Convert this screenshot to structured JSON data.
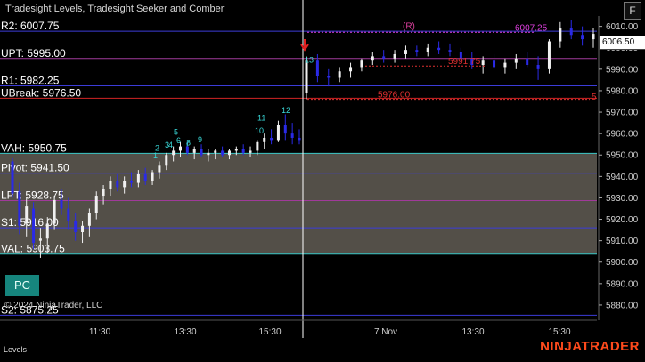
{
  "window": {
    "title": "Tradesight Levels, Tradesight Seeker and Comber",
    "f_label": "F",
    "pc_label": "PC",
    "copyright": "© 2024 NinjaTrader, LLC",
    "footer_left": "Levels",
    "brand": "NINJATRADER"
  },
  "chart_data": {
    "type": "candlestick",
    "instrument_price_label": "6006.50",
    "last_price": 6006.5,
    "ylim": [
      5875,
      6014
    ],
    "y_ticks": [
      5880,
      5890,
      5900,
      5910,
      5920,
      5930,
      5940,
      5950,
      5960,
      5970,
      5980,
      5990,
      6000,
      6010
    ],
    "x_tick_labels": [
      "11:30",
      "13:30",
      "15:30",
      "7 Nov",
      "13:30",
      "15:30"
    ],
    "session_break": "7 Nov",
    "levels": [
      {
        "label": "R2: 6007.75",
        "value": 6007.75,
        "color": "#3c3cd8"
      },
      {
        "label": "UPT: 5995.00",
        "value": 5995.0,
        "color": "#a03a9a"
      },
      {
        "label": "R1: 5982.25",
        "value": 5982.25,
        "color": "#3c3cd8"
      },
      {
        "label": "UBreak: 5976.50",
        "value": 5976.5,
        "color": "#d22424"
      },
      {
        "label": "VAH: 5950.75",
        "value": 5950.75,
        "color": "#38c6c6"
      },
      {
        "label": "Pivot: 5941.50",
        "value": 5941.5,
        "color": "#3c3cd8"
      },
      {
        "label": "LPT: 5928.75",
        "value": 5928.75,
        "color": "#a03a9a"
      },
      {
        "label": "S1: 5916.00",
        "value": 5916.0,
        "color": "#3c3cd8"
      },
      {
        "label": "VAL: 5903.75",
        "value": 5903.75,
        "color": "#38c6c6"
      },
      {
        "label": "S2: 5875.25",
        "value": 5875.25,
        "color": "#3c3cd8"
      }
    ],
    "value_area": {
      "from": 5903.75,
      "to": 5950.75,
      "color": "#5c5850"
    },
    "annotations": [
      {
        "text": "6007.25",
        "value": 6007.25,
        "color": "#e040e0"
      },
      {
        "text": "(R)",
        "value": 6008.0,
        "color": "#e040a0"
      },
      {
        "text": "5991.75",
        "value": 5991.5,
        "color": "#e03030"
      },
      {
        "text": "5976.00",
        "value": 5976.0,
        "color": "#e03030"
      },
      {
        "text": "5",
        "value": 5975.0,
        "color": "#e03030"
      }
    ],
    "seeker_counts_day1": [
      {
        "text": "1",
        "value": 5948.5
      },
      {
        "text": "2",
        "value": 5952.0
      },
      {
        "text": "3",
        "value": 5953.5
      },
      {
        "text": "4",
        "value": 5953.5
      },
      {
        "text": "5",
        "value": 5959.5
      },
      {
        "text": "6",
        "value": 5955.5
      },
      {
        "text": "7",
        "value": 5954.0
      },
      {
        "text": "8",
        "value": 5954.5
      },
      {
        "text": "9",
        "value": 5956.0
      },
      {
        "text": "10",
        "value": 5960.0
      },
      {
        "text": "11",
        "value": 5966.0
      },
      {
        "text": "12",
        "value": 5969.5
      },
      {
        "text": "13",
        "value": 5993.0
      }
    ],
    "candles": [
      [
        5947.0,
        5948.5,
        5930.0,
        5932.0
      ],
      [
        5933.0,
        5937.0,
        5913.0,
        5917.0
      ],
      [
        5918.0,
        5930.0,
        5912.0,
        5926.0
      ],
      [
        5925.0,
        5928.0,
        5906.0,
        5909.0
      ],
      [
        5910.0,
        5916.0,
        5902.0,
        5911.0
      ],
      [
        5911.0,
        5921.0,
        5904.0,
        5918.0
      ],
      [
        5918.0,
        5931.0,
        5915.0,
        5929.0
      ],
      [
        5929.0,
        5934.0,
        5922.0,
        5925.0
      ],
      [
        5925.0,
        5930.0,
        5915.0,
        5919.0
      ],
      [
        5919.0,
        5923.0,
        5910.0,
        5914.0
      ],
      [
        5914.0,
        5919.0,
        5909.0,
        5917.0
      ],
      [
        5917.0,
        5925.0,
        5912.0,
        5923.0
      ],
      [
        5923.0,
        5933.0,
        5920.0,
        5931.0
      ],
      [
        5931.0,
        5936.0,
        5927.0,
        5934.0
      ],
      [
        5934.0,
        5940.0,
        5931.0,
        5938.0
      ],
      [
        5938.0,
        5941.0,
        5933.0,
        5935.0
      ],
      [
        5935.0,
        5940.0,
        5932.0,
        5938.0
      ],
      [
        5938.0,
        5942.0,
        5935.0,
        5937.0
      ],
      [
        5937.0,
        5943.0,
        5935.0,
        5941.0
      ],
      [
        5941.0,
        5944.0,
        5936.0,
        5938.0
      ],
      [
        5938.0,
        5943.0,
        5936.0,
        5942.0
      ],
      [
        5942.0,
        5947.0,
        5939.0,
        5945.0
      ],
      [
        5945.0,
        5951.0,
        5943.0,
        5950.0
      ],
      [
        5950.0,
        5954.0,
        5947.0,
        5952.0
      ],
      [
        5952.0,
        5956.0,
        5949.0,
        5954.0
      ],
      [
        5954.0,
        5956.0,
        5950.0,
        5951.0
      ],
      [
        5951.0,
        5954.0,
        5948.0,
        5953.0
      ],
      [
        5953.0,
        5955.0,
        5949.0,
        5950.0
      ],
      [
        5950.0,
        5953.0,
        5947.0,
        5951.0
      ],
      [
        5951.0,
        5953.0,
        5948.0,
        5952.0
      ],
      [
        5952.0,
        5954.0,
        5949.0,
        5950.0
      ],
      [
        5950.0,
        5953.0,
        5948.0,
        5952.0
      ],
      [
        5952.0,
        5954.0,
        5950.0,
        5953.0
      ],
      [
        5953.0,
        5955.0,
        5950.0,
        5951.0
      ],
      [
        5951.0,
        5954.0,
        5949.0,
        5952.0
      ],
      [
        5952.0,
        5957.0,
        5950.0,
        5956.0
      ],
      [
        5956.0,
        5960.0,
        5953.0,
        5958.0
      ],
      [
        5958.0,
        5962.0,
        5955.0,
        5957.0
      ],
      [
        5957.0,
        5966.0,
        5956.0,
        5964.0
      ],
      [
        5964.0,
        5969.0,
        5957.0,
        5960.0
      ],
      [
        5960.0,
        5965.0,
        5955.0,
        5958.0
      ],
      [
        5958.0,
        5962.0,
        5955.0,
        5957.0
      ],
      [
        5979.0,
        5996.0,
        5976.0,
        5994.0
      ],
      [
        5994.0,
        5997.0,
        5984.0,
        5987.0
      ],
      [
        5987.0,
        5990.0,
        5982.0,
        5986.0
      ],
      [
        5986.0,
        5991.0,
        5984.0,
        5989.0
      ],
      [
        5989.0,
        5993.0,
        5986.0,
        5991.0
      ],
      [
        5991.0,
        5995.0,
        5989.0,
        5994.0
      ],
      [
        5994.0,
        5998.0,
        5992.0,
        5996.0
      ],
      [
        5996.0,
        5999.0,
        5993.0,
        5995.0
      ],
      [
        5995.0,
        5999.0,
        5993.0,
        5997.0
      ],
      [
        5997.0,
        6001.0,
        5995.0,
        5999.0
      ],
      [
        5999.0,
        6001.0,
        5996.0,
        5998.0
      ],
      [
        5998.0,
        6002.0,
        5996.0,
        6000.0
      ],
      [
        6000.0,
        6003.0,
        5997.0,
        5999.0
      ],
      [
        5999.0,
        6002.0,
        5996.0,
        5998.0
      ],
      [
        5998.0,
        6000.0,
        5993.0,
        5995.0
      ],
      [
        5995.0,
        5998.0,
        5990.0,
        5992.0
      ],
      [
        5992.0,
        5996.0,
        5988.0,
        5994.0
      ],
      [
        5994.0,
        5997.0,
        5990.0,
        5991.0
      ],
      [
        5991.0,
        5995.0,
        5988.0,
        5993.0
      ],
      [
        5993.0,
        5997.0,
        5990.0,
        5995.0
      ],
      [
        5995.0,
        5998.0,
        5991.0,
        5992.0
      ],
      [
        5992.0,
        5996.0,
        5985.0,
        5990.0
      ],
      [
        5990.0,
        6004.0,
        5988.0,
        6003.0
      ],
      [
        6003.0,
        6012.0,
        6000.0,
        6009.0
      ],
      [
        6009.0,
        6013.0,
        6004.0,
        6006.0
      ],
      [
        6006.0,
        6010.0,
        6001.0,
        6004.0
      ],
      [
        6004.0,
        6009.0,
        6000.0,
        6006.5
      ]
    ]
  }
}
